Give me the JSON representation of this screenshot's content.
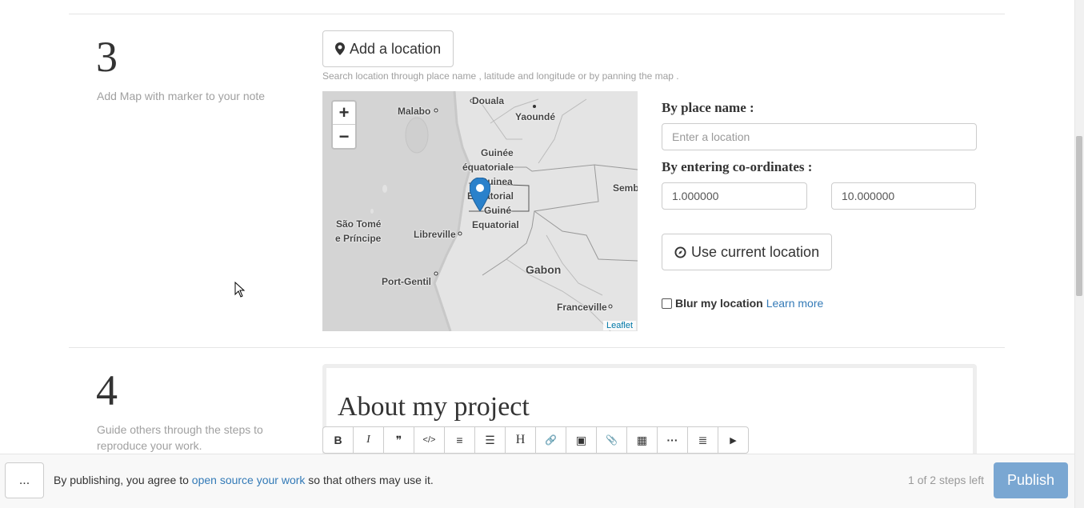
{
  "step3": {
    "number": "3",
    "description": "Add Map with marker to your note",
    "add_location_label": "Add a location",
    "hint": "Search location through place name , latitude and longitude or by panning the map .",
    "map": {
      "zoom_in": "+",
      "zoom_out": "−",
      "attribution": "Leaflet",
      "labels": {
        "douala": "Douala",
        "malabo": "Malabo",
        "yaounde": "Yaoundé",
        "guinee": "Guinée",
        "equatoriale": "équatoriale",
        "guinea": "Guinea",
        "ecuatorial": "Ecuatorial",
        "guine": "Guiné",
        "equatorial": "Equatorial",
        "sembe": "Semb",
        "sao_tome": "São Tomé",
        "e_principe": "e Príncipe",
        "libreville": "Libreville",
        "port_gentil": "Port-Gentil",
        "gabon": "Gabon",
        "franceville": "Franceville"
      }
    },
    "by_place_label": "By place name :",
    "place_placeholder": "Enter a location",
    "by_coords_label": "By entering co-ordinates :",
    "latitude": "1.000000",
    "longitude": "10.000000",
    "use_current_label": "Use current location",
    "blur_label": "Blur my location",
    "learn_more": "Learn more"
  },
  "step4": {
    "number": "4",
    "description": "Guide others through the steps to reproduce your work.",
    "editor_title": "About my project",
    "toolbar": [
      "B",
      "I",
      "❞",
      "</>",
      "≡",
      "☰",
      "H",
      "🔗",
      "▣",
      "📎",
      "▦",
      "···",
      "≣",
      "▶"
    ]
  },
  "footer": {
    "more_label": "...",
    "agree_prefix": "By publishing, you agree to ",
    "agree_link": "open source your work",
    "agree_suffix": " so that others may use it.",
    "steps_left": "1 of 2 steps left",
    "publish_label": "Publish"
  },
  "colors": {
    "link": "#337ab7",
    "publish_bg": "#7aa7d2",
    "marker": "#2a81cb"
  }
}
